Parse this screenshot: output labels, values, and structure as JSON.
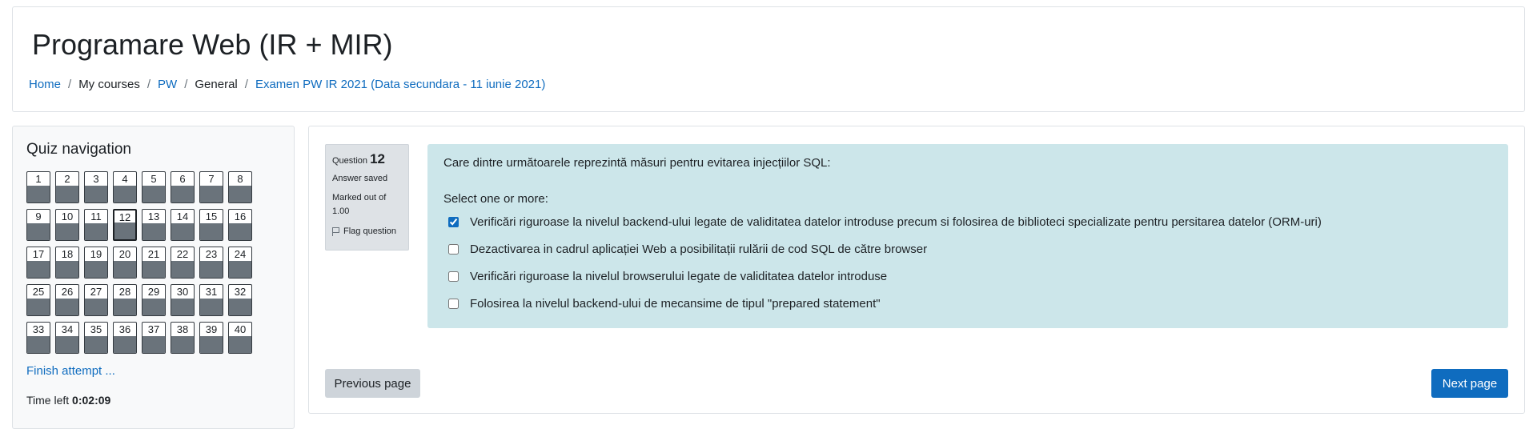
{
  "header": {
    "title": "Programare Web (IR + MIR)",
    "breadcrumb": [
      "Home",
      "My courses",
      "PW",
      "General",
      "Examen PW IR 2021 (Data secundara - 11 iunie 2021)"
    ],
    "separator": "/"
  },
  "quiz_nav": {
    "title": "Quiz navigation",
    "questions": [
      "1",
      "2",
      "3",
      "4",
      "5",
      "6",
      "7",
      "8",
      "9",
      "10",
      "11",
      "12",
      "13",
      "14",
      "15",
      "16",
      "17",
      "18",
      "19",
      "20",
      "21",
      "22",
      "23",
      "24",
      "25",
      "26",
      "27",
      "28",
      "29",
      "30",
      "31",
      "32",
      "33",
      "34",
      "35",
      "36",
      "37",
      "38",
      "39",
      "40"
    ],
    "current": "12",
    "finish_label": "Finish attempt ...",
    "time_left_label": "Time left",
    "time_left_value": "0:02:09"
  },
  "question": {
    "prefix": "Question",
    "number": "12",
    "state": "Answer saved",
    "grade": "Marked out of 1.00",
    "flag_label": "Flag question",
    "text": "Care dintre următoarele reprezintă măsuri pentru evitarea injecțiilor SQL:",
    "prompt": "Select one or more:",
    "answers": [
      {
        "label": "Verificări riguroase la nivelul backend-ului legate de validitatea datelor introduse precum si folosirea de biblioteci specializate pentru persitarea datelor (ORM-uri)",
        "checked": true
      },
      {
        "label": "Dezactivarea in cadrul aplicației Web a posibilitații rulării de cod SQL de către browser",
        "checked": false
      },
      {
        "label": "Verificări riguroase la nivelul browserului legate de validitatea datelor introduse",
        "checked": false
      },
      {
        "label": "Folosirea la nivelul backend-ului de mecansime de tipul \"prepared statement\"",
        "checked": false
      }
    ]
  },
  "buttons": {
    "previous": "Previous page",
    "next": "Next page"
  },
  "colors": {
    "accent": "#0f6cbf",
    "formulation_bg": "#cce6ea",
    "nav_fill": "#6a737b"
  }
}
